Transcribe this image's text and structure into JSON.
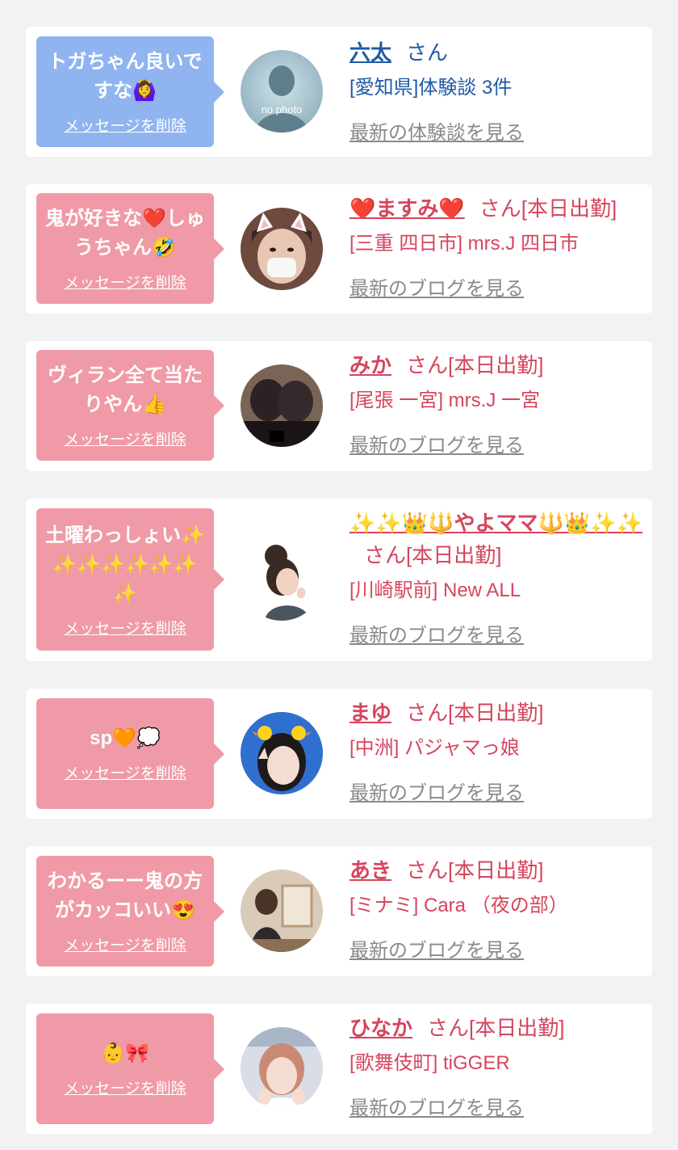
{
  "colors": {
    "page_background": "#f2f2f2",
    "card_background": "#ffffff",
    "bubble_blue": "#8fb4f0",
    "bubble_pink": "#ef9aa6",
    "text_blue": "#1f5aa6",
    "text_pink": "#d6455d",
    "link_gray": "#8a8a8a"
  },
  "messages": [
    {
      "bubble_text": "トガちゃん良いですな🙆‍♀️",
      "delete_label": "メッセージを削除",
      "name": "六太",
      "suffix": "さん",
      "shop": "[愛知県]体験談 3件",
      "link_label": "最新の体験談を見る",
      "theme": "blue",
      "avatar": "no-photo-icon"
    },
    {
      "bubble_text": "鬼が好きな❤️しゅうちゃん🤣",
      "delete_label": "メッセージを削除",
      "name": "❤️ますみ❤️",
      "suffix": "さん[本日出勤]",
      "shop": "[三重 四日市] mrs.J 四日市",
      "link_label": "最新のブログを見る",
      "theme": "pink",
      "avatar": "cat-ears-photo"
    },
    {
      "bubble_text": "ヴィラン全て当たりやん👍",
      "delete_label": "メッセージを削除",
      "name": "みか",
      "suffix": "さん[本日出勤]",
      "shop": "[尾張 一宮] mrs.J 一宮",
      "link_label": "最新のブログを見る",
      "theme": "pink",
      "avatar": "stockings-photo"
    },
    {
      "bubble_text": "土曜わっしょい✨✨✨✨✨✨✨✨",
      "delete_label": "メッセージを削除",
      "name": "✨✨👑🔱やよママ🔱👑✨✨",
      "suffix": "さん[本日出勤]",
      "shop": "[川崎駅前] New ALL",
      "link_label": "最新のブログを見る",
      "theme": "pink",
      "avatar": "updo-hair-photo"
    },
    {
      "bubble_text": "sp🧡💭",
      "delete_label": "メッセージを削除",
      "name": "まゆ",
      "suffix": "さん[本日出勤]",
      "shop": "[中洲] パジャマっ娘",
      "link_label": "最新のブログを見る",
      "theme": "pink",
      "avatar": "duck-headband-photo"
    },
    {
      "bubble_text": "わかるーー鬼の方がカッコいい😍",
      "delete_label": "メッセージを削除",
      "name": "あき",
      "suffix": "さん[本日出勤]",
      "shop": "[ミナミ] Cara （夜の部）",
      "link_label": "最新のブログを見る",
      "theme": "pink",
      "avatar": "room-photo"
    },
    {
      "bubble_text": "👶🎀",
      "delete_label": "メッセージを削除",
      "name": "ひなか",
      "suffix": "さん[本日出勤]",
      "shop": "[歌舞伎町] tiGGER",
      "link_label": "最新のブログを見る",
      "theme": "pink",
      "avatar": "pink-hair-photo"
    }
  ]
}
